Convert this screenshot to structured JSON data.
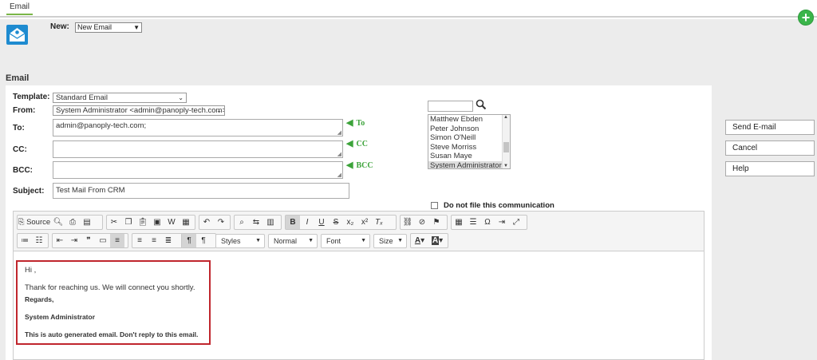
{
  "tab": {
    "label": "Email"
  },
  "header": {
    "new_label": "New:",
    "new_value": "New Email"
  },
  "section_title": "Email",
  "form": {
    "template_label": "Template:",
    "template_value": "Standard Email",
    "from_label": "From:",
    "from_value": "System Administrator <admin@panoply-tech.com>",
    "to_label": "To:",
    "to_value": "admin@panoply-tech.com;",
    "cc_label": "CC:",
    "cc_value": "",
    "bcc_label": "BCC:",
    "bcc_value": "",
    "subject_label": "Subject:",
    "subject_value": "Test Mail From CRM",
    "to_arrow": "To",
    "cc_arrow": "CC",
    "bcc_arrow": "BCC"
  },
  "contacts": {
    "search_value": "",
    "items": [
      "Matthew Ebden",
      "Peter Johnson",
      "Simon O'Neill",
      "Steve Morriss",
      "Susan Maye",
      "System Administrator"
    ],
    "selected": "System Administrator"
  },
  "do_not_file_label": "Do not file this communication",
  "toolbar": {
    "source": "Source",
    "styles": "Styles",
    "format": "Normal",
    "font": "Font",
    "size": "Size"
  },
  "body": {
    "greeting": "Hi ,",
    "line1": "Thank for reaching us. We will connect you shortly.",
    "regards": "Regards,",
    "signature": "System Administrator",
    "footer": "This is auto generated email. Don't reply to this email."
  },
  "actions": {
    "send": "Send E-mail",
    "cancel": "Cancel",
    "help": "Help"
  },
  "colors": {
    "accent_green": "#3ab54a",
    "highlight_red": "#c0262d",
    "logo_blue": "#1e8bd0"
  }
}
